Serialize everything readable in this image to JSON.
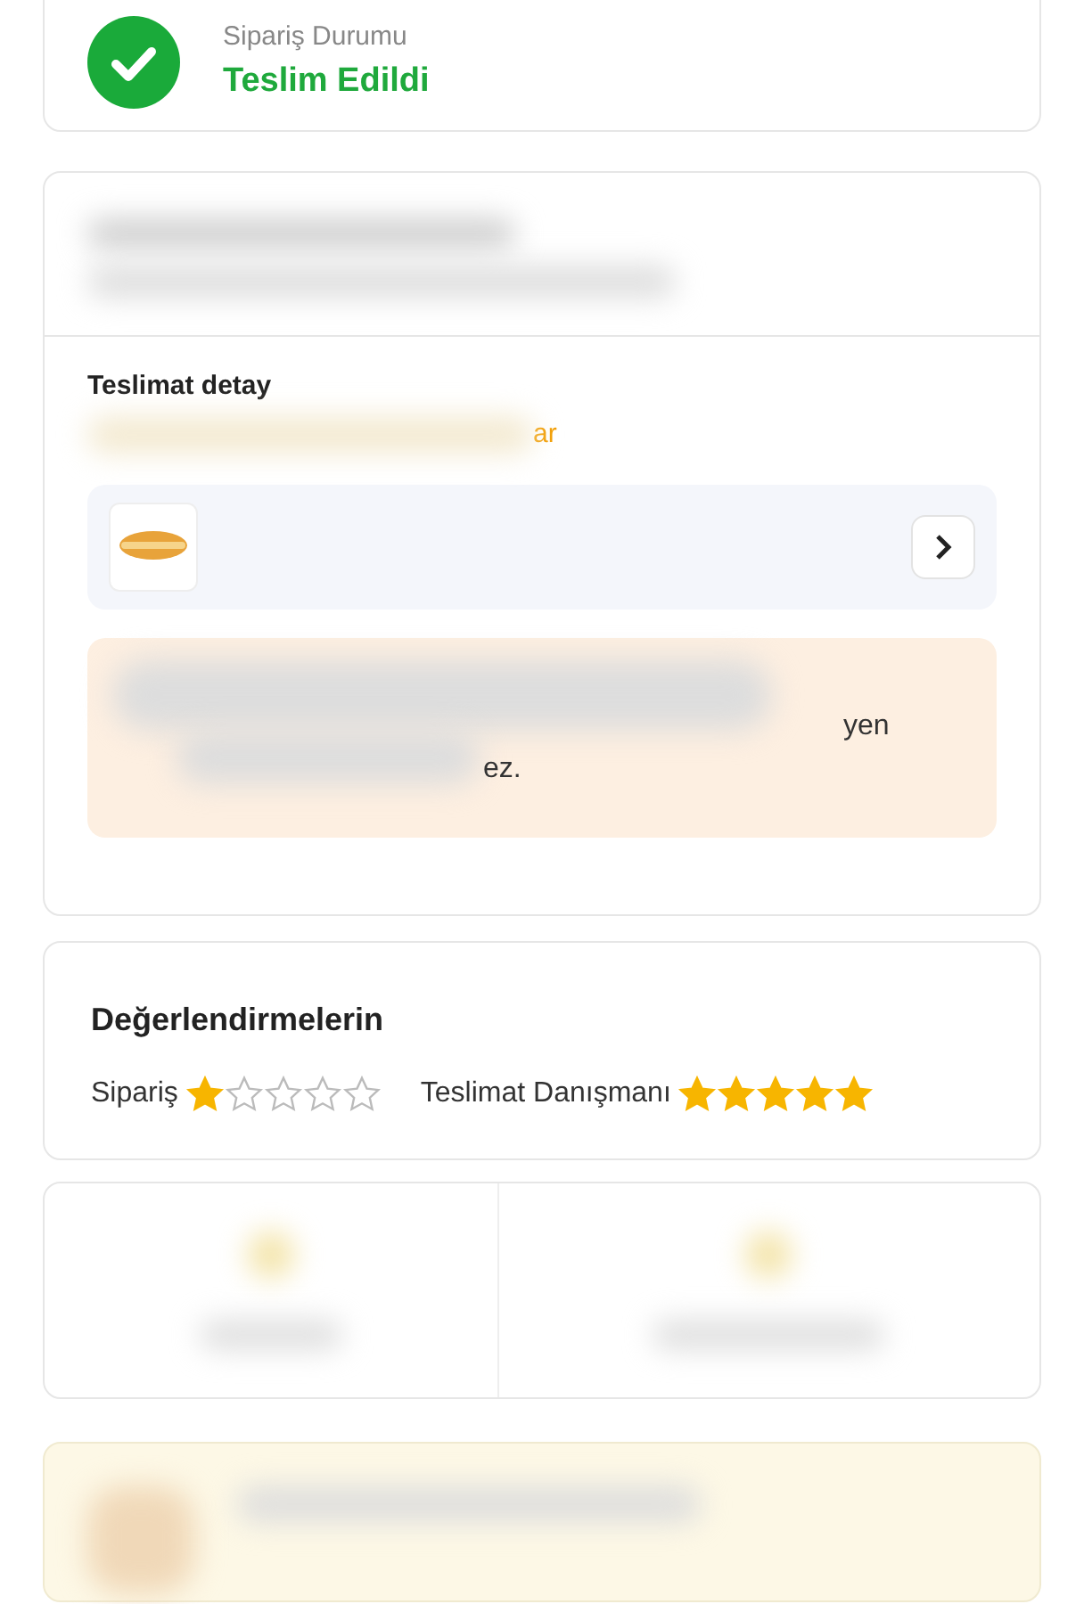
{
  "status": {
    "label": "Sipariş Durumu",
    "value": "Teslim Edildi",
    "delivered": true
  },
  "delivery": {
    "title": "Teslimat detay",
    "link_fragment": "ar",
    "notice_fragments": [
      "yen",
      "ez."
    ]
  },
  "ratings": {
    "title": "Değerlendirmelerin",
    "items": [
      {
        "label": "Sipariş",
        "stars": 1
      },
      {
        "label": "Teslimat Danışmanı",
        "stars": 5
      }
    ]
  }
}
